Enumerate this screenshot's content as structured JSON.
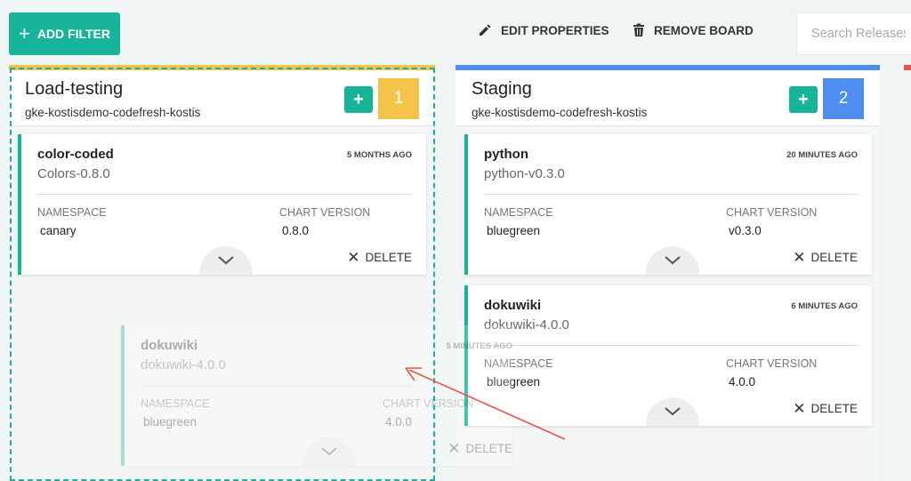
{
  "toolbar": {
    "add_filter_label": "ADD FILTER",
    "edit_properties_label": "EDIT PROPERTIES",
    "remove_board_label": "REMOVE BOARD",
    "search_placeholder": "Search Releases"
  },
  "columns": [
    {
      "title": "Load-testing",
      "subtitle": "gke-kostisdemo-codefresh-kostis",
      "count": "1",
      "color": "#f4c34a"
    },
    {
      "title": "Staging",
      "subtitle": "gke-kostisdemo-codefresh-kostis",
      "count": "2",
      "color": "#4f8df1"
    }
  ],
  "cards": [
    {
      "name": "color-coded",
      "time": "5 MONTHS AGO",
      "version": "Colors-0.8.0",
      "namespace_label": "NAMESPACE",
      "namespace": "canary",
      "chart_version_label": "CHART VERSION",
      "chart_version": "0.8.0",
      "delete_label": "DELETE"
    },
    {
      "name": "python",
      "time": "20 MINUTES AGO",
      "version": "python-v0.3.0",
      "namespace_label": "NAMESPACE",
      "namespace": "bluegreen",
      "chart_version_label": "CHART VERSION",
      "chart_version": "v0.3.0",
      "delete_label": "DELETE"
    },
    {
      "name": "dokuwiki",
      "time": "6 MINUTES AGO",
      "version": "dokuwiki-4.0.0",
      "namespace_label": "NAMESPACE",
      "namespace": "bluegreen",
      "chart_version_label": "CHART VERSION",
      "chart_version": "4.0.0",
      "delete_label": "DELETE"
    }
  ],
  "ghost_card": {
    "name": "dokuwiki",
    "time": "5 MINUTES AGO",
    "version": "dokuwiki-4.0.0",
    "namespace_label": "NAMESPACE",
    "namespace": "bluegreen",
    "chart_version_label": "CHART VERSION",
    "chart_version": "4.0.0",
    "delete_label": "DELETE"
  },
  "colors": {
    "accent": "#18b49a",
    "annotation_arrow": "#e8534a"
  }
}
